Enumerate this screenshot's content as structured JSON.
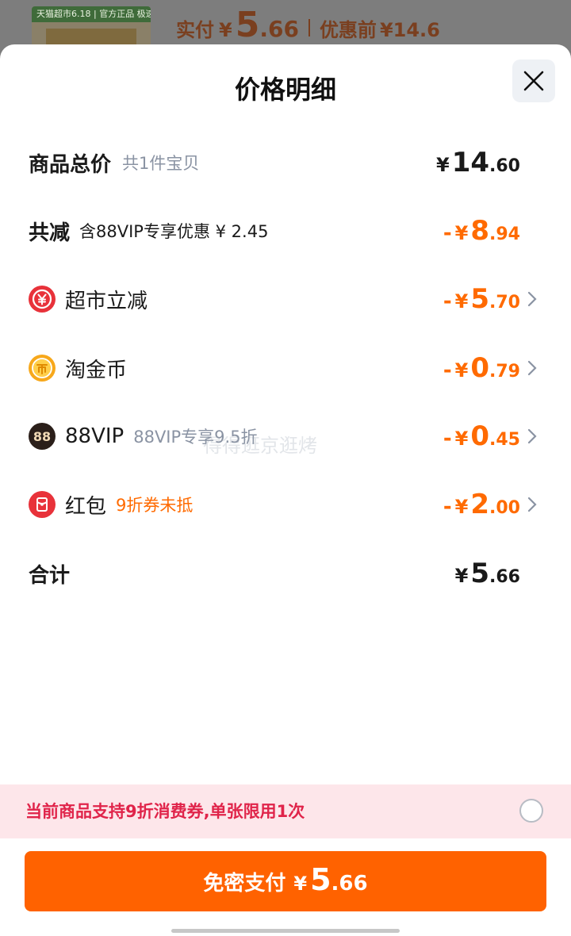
{
  "background": {
    "banner_text": "天猫超市6.18 | 官方正品 极速送达",
    "price_label": "实付",
    "currency": "¥",
    "price_int": "5",
    "price_dec": ".66",
    "original_label": "优惠前",
    "original_price": "¥14.6"
  },
  "sheet": {
    "title": "价格明细"
  },
  "rows": {
    "total": {
      "label": "商品总价",
      "sub": "共1件宝贝",
      "yen": "¥",
      "int": "14",
      "dec": ".60"
    },
    "discount": {
      "label": "共减",
      "sub": "含88VIP专享优惠 ¥ 2.45",
      "minus": "-",
      "yen": "¥",
      "int": "8",
      "dec": ".94"
    },
    "supermarket": {
      "label": "超市立减",
      "icon": "yen-coupon-icon",
      "minus": "-",
      "yen": "¥",
      "int": "5",
      "dec": ".70"
    },
    "coins": {
      "label": "淘金币",
      "icon": "gold-coin-icon",
      "minus": "-",
      "yen": "¥",
      "int": "0",
      "dec": ".79"
    },
    "vip": {
      "label": "88VIP",
      "sub": "88VIP专享9.5折",
      "icon_text": "88",
      "minus": "-",
      "yen": "¥",
      "int": "0",
      "dec": ".45"
    },
    "redpacket": {
      "label": "红包",
      "sub": "9折券未抵",
      "icon": "red-packet-icon",
      "minus": "-",
      "yen": "¥",
      "int": "2",
      "dec": ".00"
    },
    "sum": {
      "label": "合计",
      "yen": "¥",
      "int": "5",
      "dec": ".66"
    }
  },
  "watermark": "得得逛京逛烤",
  "coupon": {
    "text": "当前商品支持9折消费券,单张限用1次",
    "checked": false
  },
  "pay": {
    "label": "免密支付",
    "yen": "¥",
    "int": "5",
    "dec": ".66"
  },
  "colors": {
    "accent": "#ff6200",
    "discount": "#ff6a00",
    "coupon_text": "#e0244a",
    "coupon_bg": "#fde6ea"
  }
}
